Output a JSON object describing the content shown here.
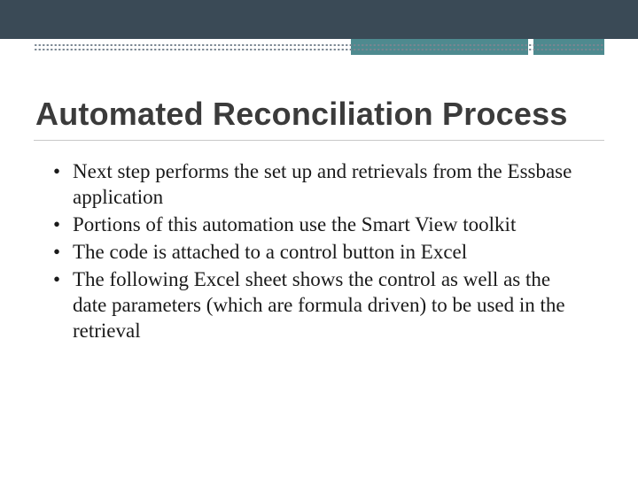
{
  "title": "Automated Reconciliation Process",
  "bullets": [
    "Next step performs the set up and retrievals from the Essbase application",
    "Portions of this automation use the Smart View toolkit",
    "The code is attached to a control button in Excel",
    "The following Excel sheet shows the control as well as the date parameters (which are formula driven) to be used in the retrieval"
  ],
  "colors": {
    "topBand": "#3a4a56",
    "accent": "#4e8a8f",
    "title": "#3b3b3b",
    "text": "#1a1a1a"
  }
}
